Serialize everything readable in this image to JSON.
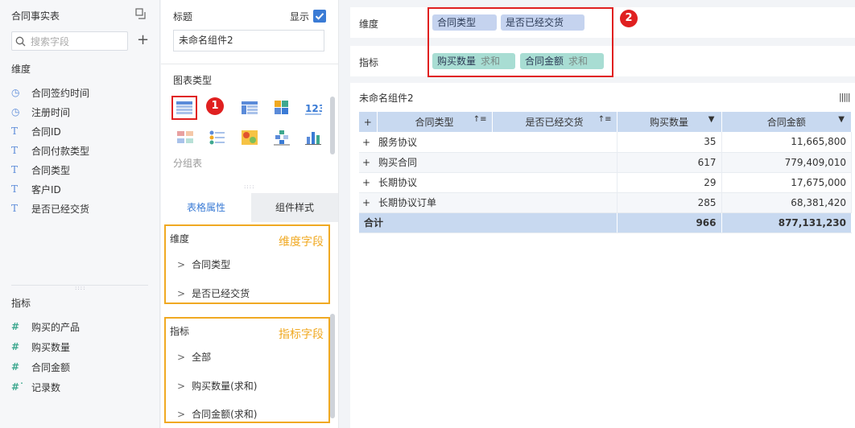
{
  "left_panel": {
    "dataset_title": "合同事实表",
    "search_placeholder": "搜索字段",
    "dimension_header": "维度",
    "dimensions": [
      {
        "label": "合同签约时间",
        "icon": "clock-icon"
      },
      {
        "label": "注册时间",
        "icon": "clock-icon"
      },
      {
        "label": "合同ID",
        "icon": "text-type-icon"
      },
      {
        "label": "合同付款类型",
        "icon": "text-type-icon"
      },
      {
        "label": "合同类型",
        "icon": "text-type-icon"
      },
      {
        "label": "客户ID",
        "icon": "text-type-icon"
      },
      {
        "label": "是否已经交货",
        "icon": "text-type-icon"
      }
    ],
    "measure_header": "指标",
    "measures": [
      {
        "label": "购买的产品",
        "icon": "number-icon"
      },
      {
        "label": "购买数量",
        "icon": "number-icon"
      },
      {
        "label": "合同金额",
        "icon": "number-icon"
      },
      {
        "label": "记录数",
        "icon": "count-icon"
      }
    ]
  },
  "middle_panel": {
    "title_label": "标题",
    "show_label": "显示",
    "title_value": "未命名组件2",
    "chart_type_label": "图表类型",
    "group_label": "分组表",
    "tabs": [
      "表格属性",
      "组件样式"
    ],
    "dim_box": {
      "header": "维度",
      "tag": "维度字段",
      "items": [
        "合同类型",
        "是否已经交货"
      ]
    },
    "measure_box": {
      "header": "指标",
      "tag": "指标字段",
      "items": [
        "全部",
        "购买数量(求和)",
        "合同金额(求和)"
      ]
    },
    "badge1": "1"
  },
  "right_panel": {
    "dim_bar_label": "维度",
    "dim_pills": [
      "合同类型",
      "是否已经交货"
    ],
    "measure_bar_label": "指标",
    "measure_pills": [
      {
        "name": "购买数量",
        "agg": "求和"
      },
      {
        "name": "合同金额",
        "agg": "求和"
      }
    ],
    "badge2": "2",
    "widget_title": "未命名组件2",
    "table": {
      "headers": [
        "合同类型",
        "是否已经交货",
        "购买数量",
        "合同金额"
      ],
      "rows": [
        {
          "type": "服务协议",
          "qty": "35",
          "amount": "11,665,800"
        },
        {
          "type": "购买合同",
          "qty": "617",
          "amount": "779,409,010"
        },
        {
          "type": "长期协议",
          "qty": "29",
          "amount": "17,675,000"
        },
        {
          "type": "长期协议订单",
          "qty": "285",
          "amount": "68,381,420"
        }
      ],
      "total_label": "合计",
      "total_qty": "966",
      "total_amount": "877,131,230"
    }
  },
  "colors": {
    "accent": "#3a7bd5",
    "annotation_red": "#e02020",
    "annotation_orange": "#f0a922",
    "header_blue": "#c8d9f0"
  }
}
